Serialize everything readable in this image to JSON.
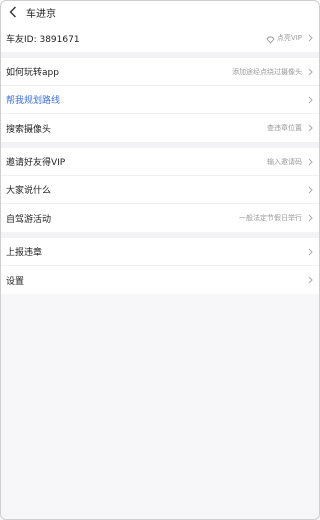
{
  "header": {
    "title": "车进京"
  },
  "account": {
    "id_label": "车友ID: 3891671",
    "vip_label": "点亮VIP"
  },
  "group1": [
    {
      "name": "menu-how-to-use",
      "label": "如何玩转app",
      "value": "添加途经点绕过摄像头",
      "blue": false
    },
    {
      "name": "menu-plan-route",
      "label": "帮我规划路线",
      "value": "",
      "blue": true
    },
    {
      "name": "menu-search-camera",
      "label": "搜索摄像头",
      "value": "查违章位置",
      "blue": false
    }
  ],
  "group2": [
    {
      "name": "menu-invite-friends",
      "label": "邀请好友得VIP",
      "value": "输入邀请码"
    },
    {
      "name": "menu-community",
      "label": "大家说什么",
      "value": ""
    },
    {
      "name": "menu-road-trip",
      "label": "自驾游活动",
      "value": "一般法定节假日举行"
    }
  ],
  "group3": [
    {
      "name": "menu-report-violation",
      "label": "上报违章",
      "value": ""
    },
    {
      "name": "menu-settings",
      "label": "设置",
      "value": ""
    }
  ],
  "colors": {
    "accent_blue": "#3b6fe0",
    "background": "#f7f7f9",
    "secondary_text": "#999999"
  },
  "icons": {
    "back": "chevron-left-icon",
    "row_arrow": "chevron-right-icon",
    "vip": "diamond-icon"
  }
}
